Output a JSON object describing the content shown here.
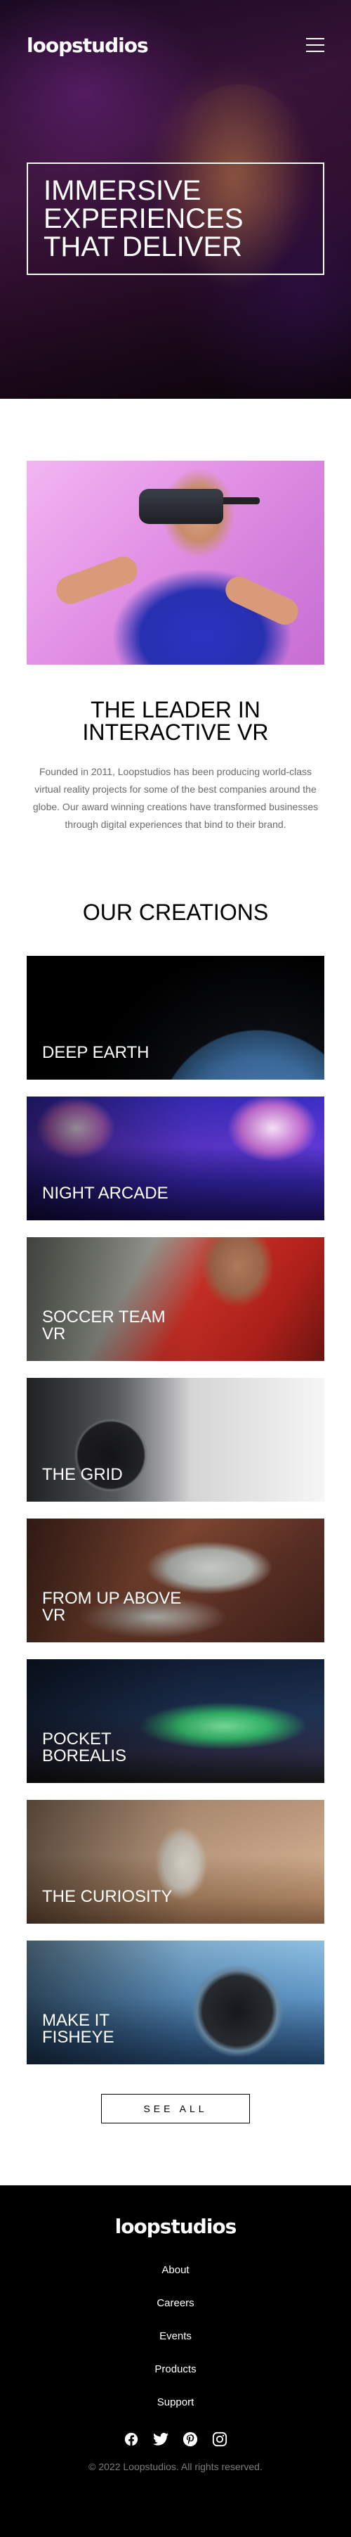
{
  "header": {
    "logo": "loopstudios",
    "menu_icon": "hamburger-menu-icon"
  },
  "hero": {
    "headline": "IMMERSIVE EXPERIENCES THAT DELIVER"
  },
  "intro": {
    "heading": "THE LEADER IN INTERACTIVE VR",
    "body": "Founded in 2011, Loopstudios has been producing world-class virtual reality projects for some of the best companies around the globe. Our award winning creations have transformed businesses through digital experiences that bind to their brand."
  },
  "creations": {
    "heading": "OUR CREATIONS",
    "items": [
      {
        "title": "DEEP EARTH"
      },
      {
        "title": "NIGHT ARCADE"
      },
      {
        "title": "SOCCER TEAM VR"
      },
      {
        "title": "THE GRID"
      },
      {
        "title": "FROM UP ABOVE VR"
      },
      {
        "title": "POCKET BOREALIS"
      },
      {
        "title": "THE CURIOSITY"
      },
      {
        "title": "MAKE IT FISHEYE"
      }
    ],
    "see_all_label": "SEE ALL"
  },
  "footer": {
    "logo": "loopstudios",
    "nav": [
      "About",
      "Careers",
      "Events",
      "Products",
      "Support"
    ],
    "social_icons": [
      "facebook-icon",
      "twitter-icon",
      "pinterest-icon",
      "instagram-icon"
    ],
    "copyright": "© 2022 Loopstudios. All rights reserved."
  }
}
